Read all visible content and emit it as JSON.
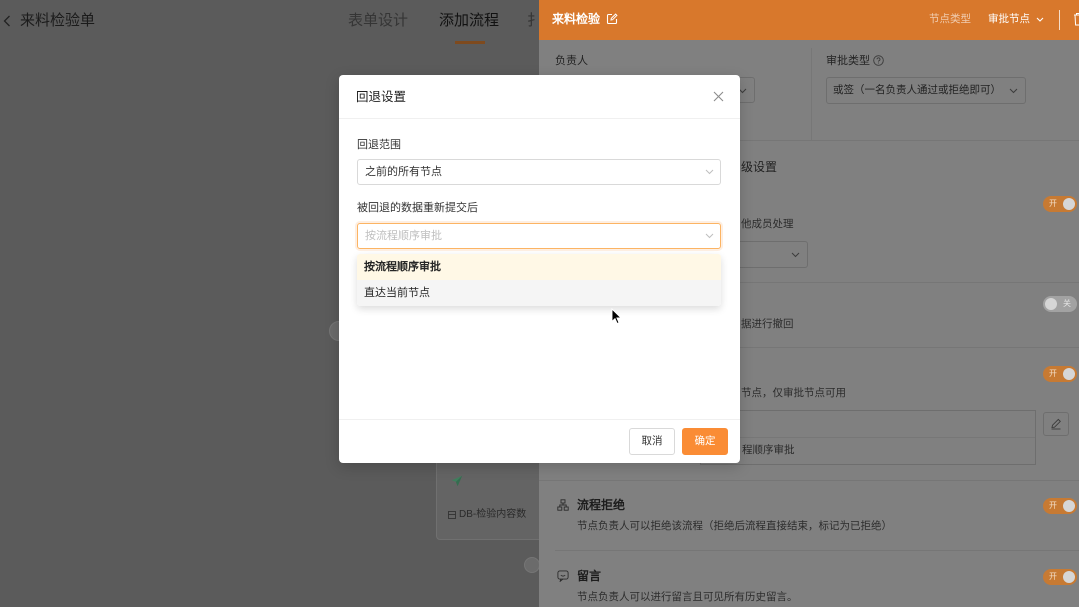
{
  "header": {
    "back_icon": "chevron-left-icon",
    "title": "来料检验单",
    "tabs": [
      {
        "label": "表单设计",
        "active": false
      },
      {
        "label": "添加流程",
        "active": true
      },
      {
        "label": "扌",
        "active": false
      }
    ]
  },
  "canvas": {
    "node": {
      "icon": "send-icon",
      "field_icon": "database-icon",
      "field_label": "DB-检验内容数"
    }
  },
  "drawer": {
    "title": "来料检验",
    "title_icon": "edit-icon",
    "node_type_label": "节点类型",
    "node_type_value": "审批节点",
    "owner_label": "负责人",
    "approval_type_label": "审批类型",
    "approval_type_icon": "help-circle-icon",
    "approval_type_value": "或签（一名负责人通过或拒绝即可）",
    "advanced_title": "级设置",
    "settings": [
      {
        "desc": "他成员处理",
        "toggle_label": "开",
        "on": true
      },
      {
        "desc": "据进行撤回",
        "toggle_label": "关",
        "on": false
      },
      {
        "desc": "节点，仅审批节点可用",
        "toggle_label": "开",
        "on": true,
        "summary_value": "程顺序审批",
        "edit_icon": "pencil-icon"
      },
      {
        "icon": "branch-icon",
        "title": "流程拒绝",
        "desc": "节点负责人可以拒绝该流程（拒绝后流程直接结束，标记为已拒绝）",
        "toggle_label": "开",
        "on": true
      },
      {
        "icon": "message-icon",
        "title": "留言",
        "desc": "节点负责人可以进行留言且可见所有历史留言。",
        "toggle_label": "开",
        "on": true
      }
    ]
  },
  "modal": {
    "title": "回退设置",
    "close_icon": "close-icon",
    "rollback_range_label": "回退范围",
    "rollback_range_value": "之前的所有节点",
    "resubmit_label": "被回退的数据重新提交后",
    "resubmit_placeholder": "按流程顺序审批",
    "resubmit_options": [
      {
        "label": "按流程顺序审批",
        "selected": true
      },
      {
        "label": "直达当前节点",
        "selected": false,
        "hovered": true
      }
    ],
    "cancel_label": "取消",
    "confirm_label": "确定"
  },
  "colors": {
    "accent": "#fa8c35",
    "drawer_header": "#d8782c",
    "focus_border": "#fcb463",
    "selected_option_bg": "#fff8e6"
  }
}
